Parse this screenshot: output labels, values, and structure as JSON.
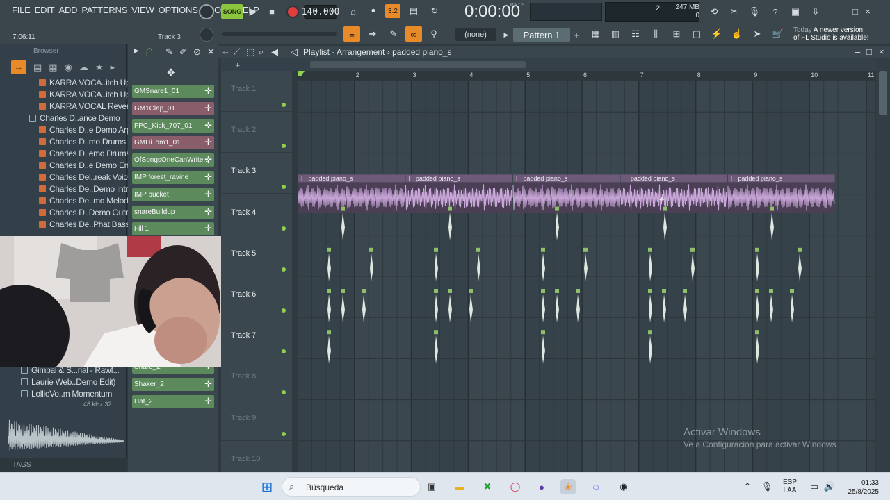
{
  "menu": [
    "FILE",
    "EDIT",
    "ADD",
    "PATTERNS",
    "VIEW",
    "OPTIONS",
    "TOOLS",
    "HELP"
  ],
  "transport": {
    "song_label": "SONG",
    "tempo": "140.000",
    "time": "0:00:00",
    "time_unit": "M:S:CS",
    "beat_badge": "3.2"
  },
  "hint": {
    "time": "7:06:11",
    "track": "Track 3"
  },
  "perf": {
    "cpu_value": "2",
    "memory": "247 MB",
    "poly": "0"
  },
  "toolbar2": {
    "none_label": "(none)",
    "pattern_label": "Pattern 1"
  },
  "update": {
    "line1": "Today",
    "line1b": "A newer version",
    "line2": "of FL Studio is available!"
  },
  "browser": {
    "title": "Browser",
    "items": [
      {
        "label": "KARRA VOCA..itch Up 2",
        "type": "wav"
      },
      {
        "label": "KARRA VOCA..itch Up 3",
        "type": "wav"
      },
      {
        "label": "KARRA VOCAL Reversed",
        "type": "wav"
      },
      {
        "label": "Charles D..ance Demo",
        "type": "folder"
      },
      {
        "label": "Charles D..e Demo Arp",
        "type": "wav"
      },
      {
        "label": "Charles D..mo Drums 2",
        "type": "wav"
      },
      {
        "label": "Charles D..emo Drums",
        "type": "wav"
      },
      {
        "label": "Charles D..e Demo End",
        "type": "wav"
      },
      {
        "label": "Charles Del..reak Voice",
        "type": "wav"
      },
      {
        "label": "Charles De..Demo Intro",
        "type": "wav"
      },
      {
        "label": "Charles De..mo Melody",
        "type": "wav"
      },
      {
        "label": "Charles D..Demo Outro",
        "type": "wav"
      },
      {
        "label": "Charles De..Phat Bass",
        "type": "wav"
      }
    ],
    "lower_items": [
      {
        "label": "Gimbal & S...rial - Rawf...",
        "type": "folder"
      },
      {
        "label": "Laurie Web..Demo Edit)",
        "type": "folder"
      },
      {
        "label": "LollieVo..m Momentum",
        "type": "folder"
      }
    ],
    "sample_info": "48 kHz 32",
    "tags_label": "TAGS"
  },
  "channels": [
    {
      "label": "GMSnare1_01",
      "color": "#5d8a5c"
    },
    {
      "label": "GM1Clap_01",
      "color": "#8a5d6a"
    },
    {
      "label": "FPC_Kick_707_01",
      "color": "#5d8a5c"
    },
    {
      "label": "GMHiTom1_01",
      "color": "#8a5d6a"
    },
    {
      "label": "OfSongsOneCanWrite...",
      "color": "#5d8a5c"
    },
    {
      "label": "IMP forest_ravine",
      "color": "#5d8a5c"
    },
    {
      "label": "IMP bucket",
      "color": "#5d8a5c"
    },
    {
      "label": "snareBuildup",
      "color": "#5d8a5c"
    },
    {
      "label": "Fill 1",
      "color": "#5d8a5c"
    }
  ],
  "channels_lower": [
    {
      "label": "Snare_2",
      "color": "#5d8a5c"
    },
    {
      "label": "Shaker_2",
      "color": "#5d8a5c"
    },
    {
      "label": "Hat_2",
      "color": "#5d8a5c"
    }
  ],
  "playlist": {
    "title": "Playlist - Arrangement",
    "clip_name": "padded piano_s",
    "bars": [
      "2",
      "3",
      "4",
      "5",
      "6",
      "7",
      "8",
      "9",
      "10",
      "11"
    ],
    "tracks": [
      "Track 1",
      "Track 2",
      "Track 3",
      "Track 4",
      "Track 5",
      "Track 6",
      "Track 7",
      "Track 8",
      "Track 9",
      "Track 10"
    ],
    "clip_labels": [
      "padded piano_s",
      "padded piano_s",
      "padded piano_s",
      "padded piano_s",
      "padded piano_s"
    ]
  },
  "watermark": {
    "line1": "Activar Windows",
    "line2": "Ve a Configuración para activar Windows."
  },
  "taskbar": {
    "search_placeholder": "Búsqueda",
    "lang1": "ESP",
    "lang2": "LAA",
    "time": "01:33",
    "date": "25/8/2025"
  },
  "colors": {
    "accent": "#e88a28",
    "clip": "#c9a6d8",
    "green": "#8cc63f",
    "rec": "#e23c3c"
  }
}
